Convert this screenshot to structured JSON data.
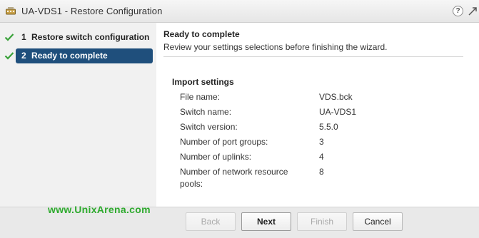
{
  "window": {
    "title": "UA-VDS1 - Restore Configuration",
    "help_symbol": "?"
  },
  "nav": {
    "steps": [
      {
        "number": "1",
        "label": "Restore switch configuration",
        "completed": true,
        "active": false
      },
      {
        "number": "2",
        "label": "Ready to complete",
        "completed": true,
        "active": true
      }
    ]
  },
  "main": {
    "title": "Ready to complete",
    "subtitle": "Review your settings selections before finishing the wizard.",
    "import_heading": "Import settings",
    "settings": [
      {
        "label": "File name:",
        "value": "VDS.bck"
      },
      {
        "label": "Switch name:",
        "value": "UA-VDS1"
      },
      {
        "label": "Switch version:",
        "value": "5.5.0"
      },
      {
        "label": "Number of port groups:",
        "value": "3"
      },
      {
        "label": "Number of uplinks:",
        "value": "4"
      },
      {
        "label": "Number of network resource pools:",
        "value": "8"
      }
    ]
  },
  "footer": {
    "watermark": "www.UnixArena.com",
    "back_label": "Back",
    "next_label": "Next",
    "finish_label": "Finish",
    "cancel_label": "Cancel"
  },
  "colors": {
    "active_step": "#1f4f7c",
    "check": "#3aa23a",
    "watermark": "#2eaa2e"
  }
}
